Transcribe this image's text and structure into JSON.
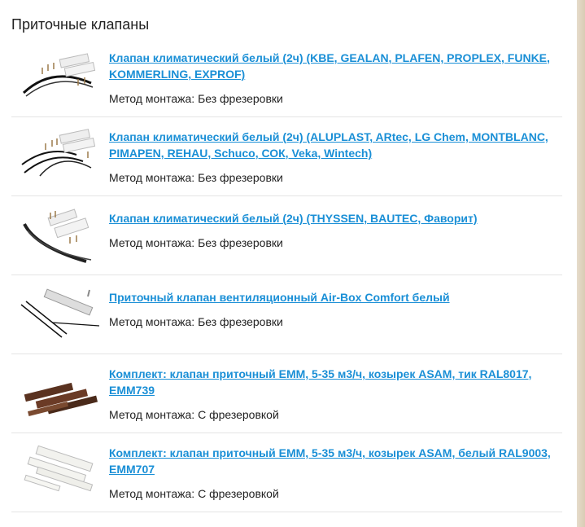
{
  "page": {
    "title": "Приточные клапаны"
  },
  "method_label": "Метод монтажа:",
  "products": [
    {
      "name": "Клапан климатический белый (2ч) (KBE, GEALAN, PLAFEN, PROPLEX, FUNKE, KOMMERLING, EXPROF)",
      "method": "Без фрезеровки",
      "image": "white-valve-with-curved-black-strips"
    },
    {
      "name": "Клапан климатический белый (2ч) (ALUPLAST, ARtec, LG Chem, MONTBLANC, PIMAPEN, REHAU, Schuco, СОК, Veka, Wintech)",
      "method": "Без фрезеровки",
      "image": "white-valve-with-curved-black-strips"
    },
    {
      "name": "Клапан климатический белый (2ч) (THYSSEN, BAUTEC, Фаворит)",
      "method": "Без фрезеровки",
      "image": "white-valve-with-curved-black-strips"
    },
    {
      "name": "Приточный клапан вентиляционный Air-Box Comfort белый",
      "method": "Без фрезеровки",
      "image": "air-box-valve-with-seals"
    },
    {
      "name": "Комплект: клапан приточный EMM, 5-35 м3/ч, козырек ASAM, тик RAL8017, EMM739",
      "method": "С фрезеровкой",
      "image": "brown-emm-valve-kit"
    },
    {
      "name": "Комплект: клапан приточный EMM, 5-35 м3/ч, козырек ASAM, белый RAL9003, EMM707",
      "method": "С фрезеровкой",
      "image": "white-emm-valve-kit"
    }
  ]
}
